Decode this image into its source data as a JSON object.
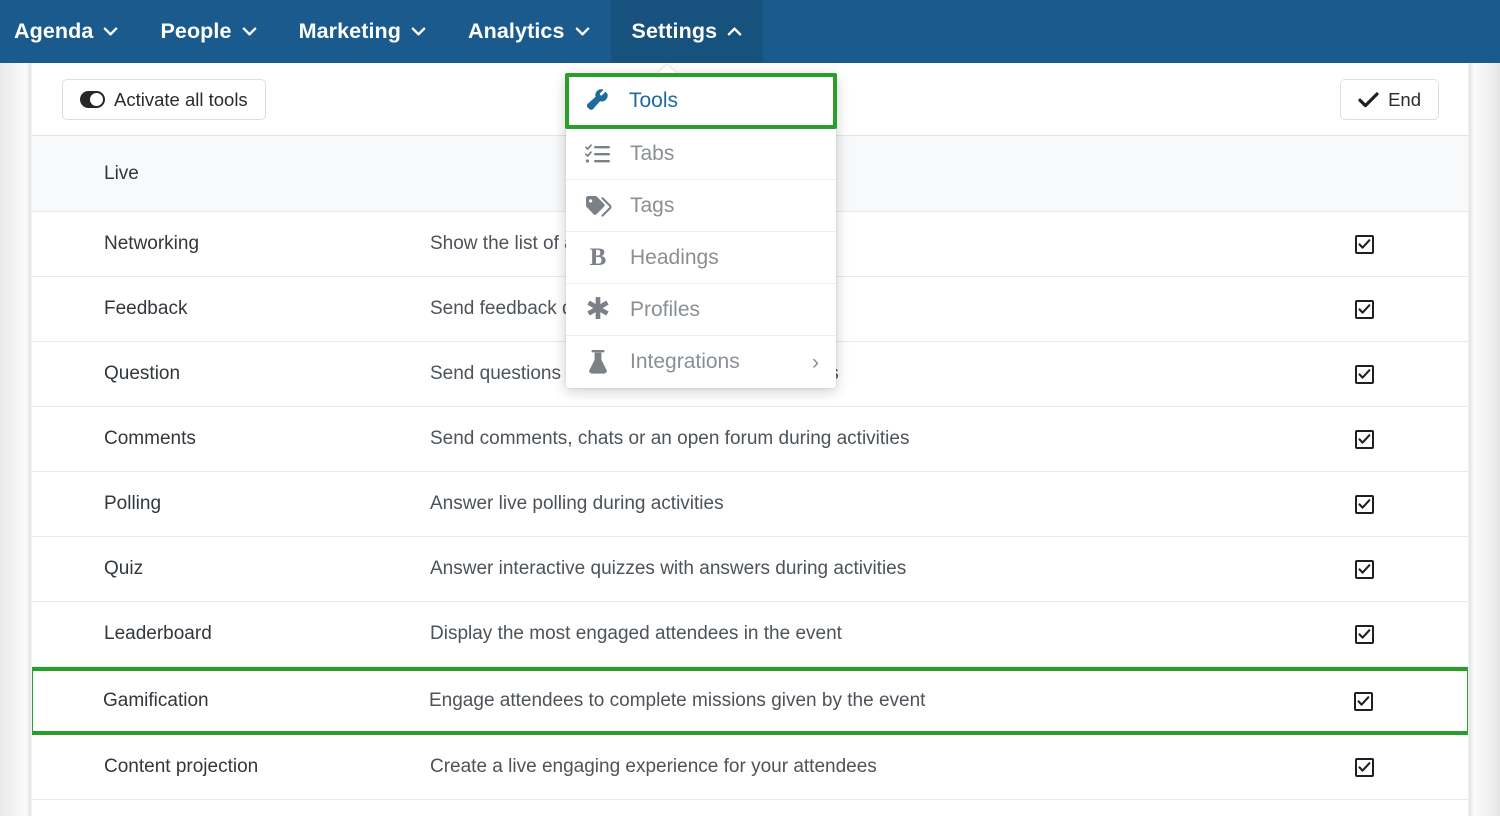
{
  "nav": {
    "items": [
      {
        "label": "Agenda",
        "caret": "chevron-down-icon",
        "active": false
      },
      {
        "label": "People",
        "caret": "chevron-down-icon",
        "active": false
      },
      {
        "label": "Marketing",
        "caret": "chevron-down-icon",
        "active": false
      },
      {
        "label": "Analytics",
        "caret": "chevron-down-icon",
        "active": false
      },
      {
        "label": "Settings",
        "caret": "chevron-up-icon",
        "active": true
      }
    ]
  },
  "toolbar": {
    "activate_all_label": "Activate all tools",
    "activate_all_icon": "toggle-switch-icon",
    "end_label": "End",
    "end_icon": "check-icon"
  },
  "dropdown": {
    "items": [
      {
        "label": "Tools",
        "icon": "wrench-icon",
        "selected": true,
        "submenu": false
      },
      {
        "label": "Tabs",
        "icon": "checklist-icon",
        "selected": false,
        "submenu": false
      },
      {
        "label": "Tags",
        "icon": "tag-icon",
        "selected": false,
        "submenu": false
      },
      {
        "label": "Headings",
        "icon": "bold-b-icon",
        "selected": false,
        "submenu": false
      },
      {
        "label": "Profiles",
        "icon": "asterisk-icon",
        "selected": false,
        "submenu": false
      },
      {
        "label": "Integrations",
        "icon": "flask-icon",
        "selected": false,
        "submenu": true,
        "submenu_icon": "chevron-right-icon"
      }
    ]
  },
  "table": {
    "rows": [
      {
        "type": "section",
        "name": "Live",
        "desc": "",
        "checked": null,
        "highlight": false
      },
      {
        "type": "tool",
        "name": "Networking",
        "desc": "Show the list of attendees",
        "checked": true,
        "highlight": false
      },
      {
        "type": "tool",
        "name": "Feedback",
        "desc": "Send feedback during activities",
        "checked": true,
        "highlight": false
      },
      {
        "type": "tool",
        "name": "Question",
        "desc": "Send questions or post live Q&A during activities",
        "checked": true,
        "highlight": false
      },
      {
        "type": "tool",
        "name": "Comments",
        "desc": "Send comments, chats or an open forum during activities",
        "checked": true,
        "highlight": false
      },
      {
        "type": "tool",
        "name": "Polling",
        "desc": "Answer live polling during activities",
        "checked": true,
        "highlight": false
      },
      {
        "type": "tool",
        "name": "Quiz",
        "desc": "Answer interactive quizzes with answers during activities",
        "checked": true,
        "highlight": false
      },
      {
        "type": "tool",
        "name": "Leaderboard",
        "desc": "Display the most engaged attendees in the event",
        "checked": true,
        "highlight": false
      },
      {
        "type": "tool",
        "name": "Gamification",
        "desc": "Engage attendees to complete missions given by the event",
        "checked": true,
        "highlight": true
      },
      {
        "type": "tool",
        "name": "Content projection",
        "desc": "Create a live engaging experience for your attendees",
        "checked": true,
        "highlight": false
      }
    ]
  },
  "colors": {
    "nav_background": "#1a5a8c",
    "nav_active_background": "#17517e",
    "highlight_green": "#2a9d2a",
    "link_blue": "#1e6b9e",
    "section_background": "#f7f9fb"
  }
}
